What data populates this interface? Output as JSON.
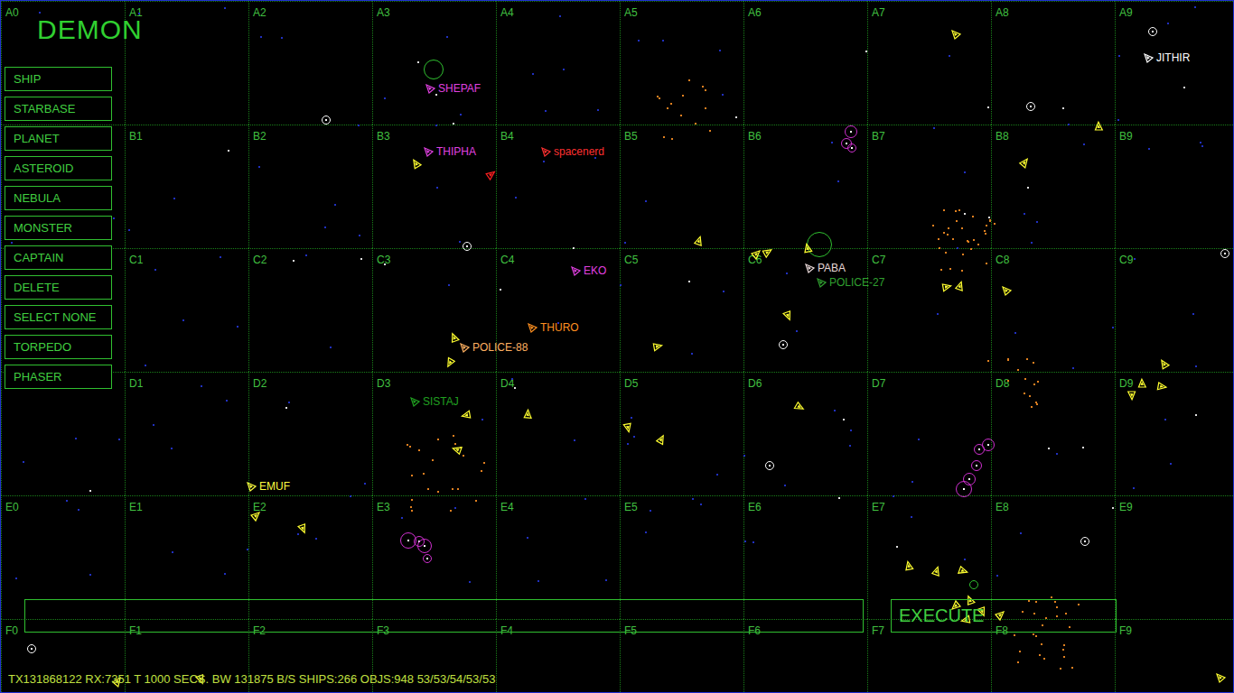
{
  "title": "DEMON",
  "menu": [
    {
      "label": "SHIP"
    },
    {
      "label": "STARBASE"
    },
    {
      "label": "PLANET"
    },
    {
      "label": "ASTEROID"
    },
    {
      "label": "NEBULA"
    },
    {
      "label": "MONSTER"
    },
    {
      "label": "CAPTAIN"
    },
    {
      "label": "DELETE"
    },
    {
      "label": "SELECT NONE"
    },
    {
      "label": "TORPEDO"
    },
    {
      "label": "PHASER"
    }
  ],
  "grid": {
    "rows": [
      [
        "A0",
        "A1",
        "A2",
        "A3",
        "A4",
        "A5",
        "A6",
        "A7",
        "A8",
        "A9"
      ],
      [
        null,
        "B1",
        "B2",
        "B3",
        "B4",
        "B5",
        "B6",
        "B7",
        "B8",
        "B9"
      ],
      [
        null,
        "C1",
        "C2",
        "C3",
        "C4",
        "C5",
        "C6",
        "C7",
        "C8",
        "C9"
      ],
      [
        null,
        "D1",
        "D2",
        "D3",
        "D4",
        "D5",
        "D6",
        "D7",
        "D8",
        "D9"
      ],
      [
        "E0",
        "E1",
        "E2",
        "E3",
        "E4",
        "E5",
        "E6",
        "E7",
        "E8",
        "E9"
      ],
      [
        "F0",
        "F1",
        "F2",
        "F3",
        "F4",
        "F5",
        "F6",
        "F7",
        "F8",
        "F9"
      ]
    ]
  },
  "ships": [
    {
      "name": "SHEPAF",
      "color": "#e040e0"
    },
    {
      "name": "THIPHA",
      "color": "#e040e0"
    },
    {
      "name": "spacenerd",
      "color": "#ff3030"
    },
    {
      "name": "EKO",
      "color": "#e040e0"
    },
    {
      "name": "THURO",
      "color": "#ff9020"
    },
    {
      "name": "POLICE-88",
      "color": "#ffb060"
    },
    {
      "name": "PABA",
      "color": "#e8d8d8"
    },
    {
      "name": "POLICE-27",
      "color": "#30a030"
    },
    {
      "name": "SISTAJ",
      "color": "#20a020"
    },
    {
      "name": "EMUF",
      "color": "#ffff40"
    },
    {
      "name": "JITHIR",
      "color": "#ffffff"
    }
  ],
  "command": {
    "value": ""
  },
  "execute": "EXECUTE",
  "status_bar": "TX131868122 RX:7351 T 1000 SECS. BW 131875 B/S SHIPS:266 OBJS:948 53/53/54/53/53"
}
